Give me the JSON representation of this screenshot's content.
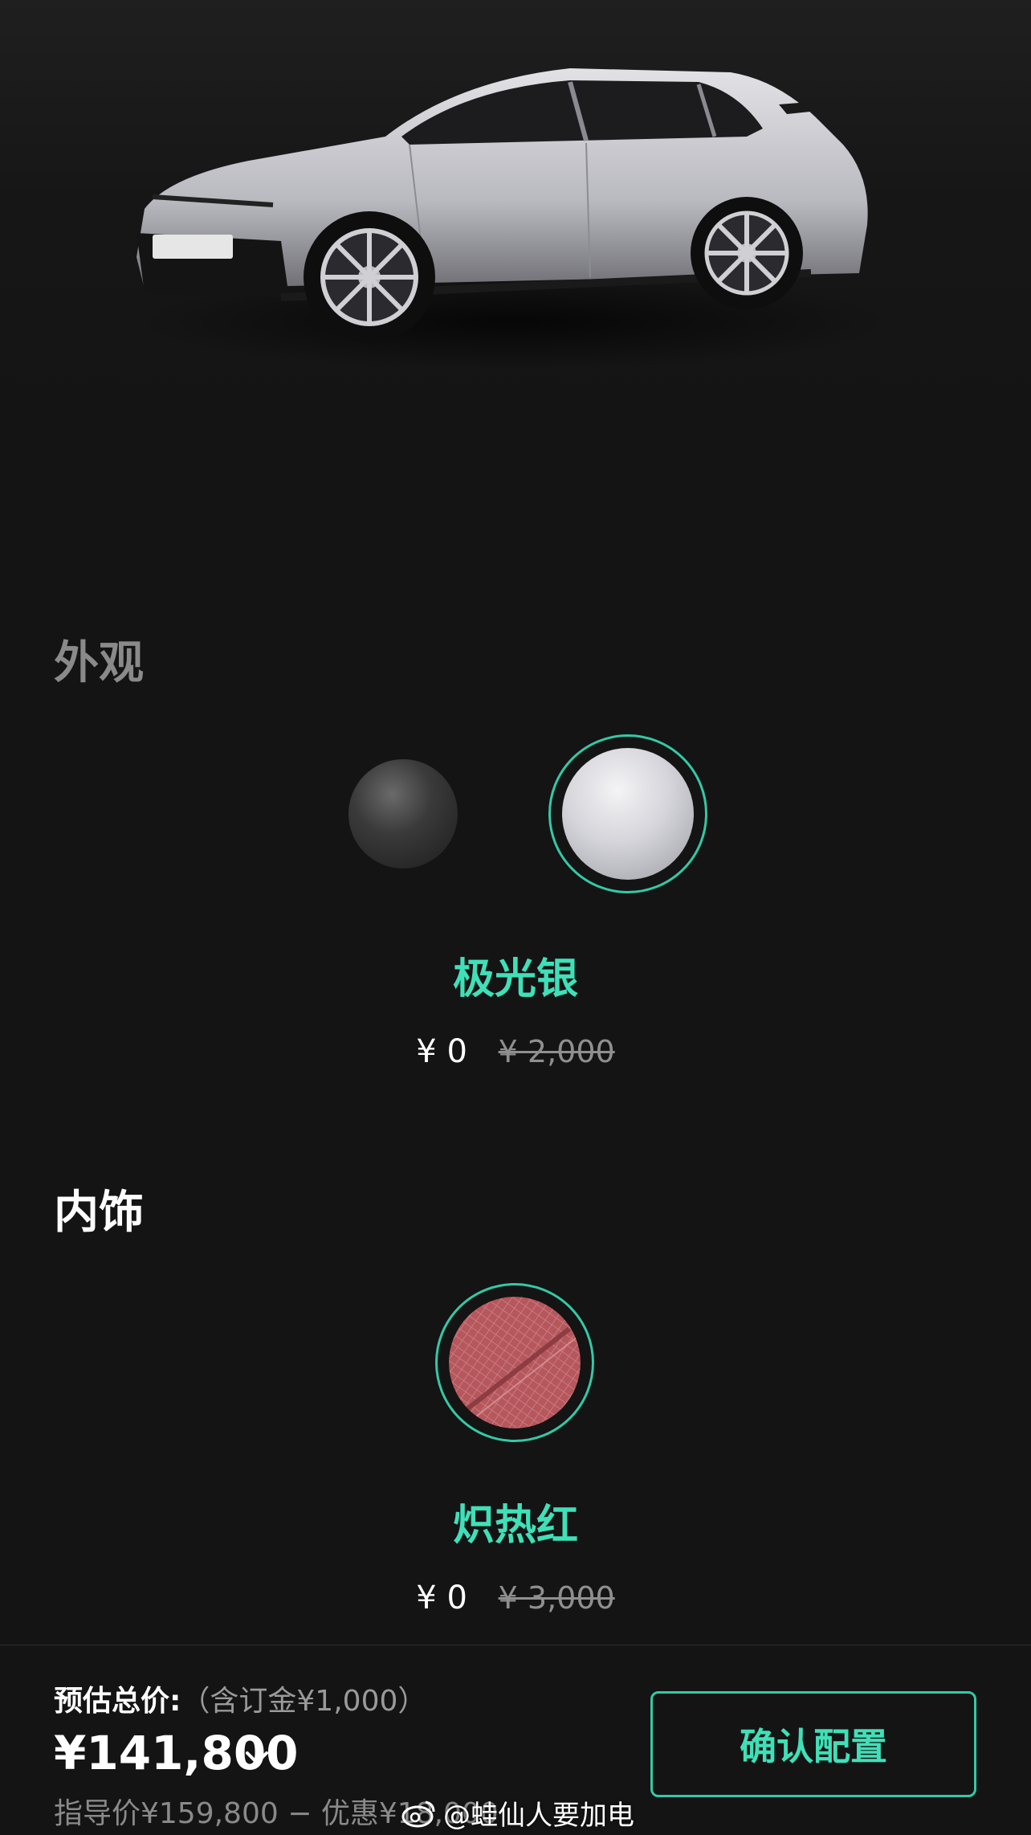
{
  "exterior": {
    "title": "外观",
    "options": [
      {
        "icon": "exterior-black-swatch",
        "color": "#3a3a3a"
      },
      {
        "icon": "exterior-silver-swatch",
        "color": "#d8d8dc",
        "selected": true
      }
    ],
    "selected_name": "极光银",
    "price": "¥ 0",
    "old_price": "¥ 2,000"
  },
  "interior": {
    "title": "内饰",
    "options": [
      {
        "icon": "interior-red-swatch",
        "color": "#b5575c",
        "selected": true
      }
    ],
    "selected_name": "炽热红",
    "price": "¥ 0",
    "old_price": "¥ 3,000"
  },
  "footer": {
    "estimate_label": "预估总价:",
    "estimate_note": "（含订金¥1,000）",
    "total": "¥141,800",
    "guide": "指导价¥159,800 − 优惠¥18,000",
    "confirm_label": "确认配置"
  },
  "watermark": "@蛙仙人要加电",
  "colors": {
    "accent": "#3fe0b8",
    "background": "#141414"
  }
}
